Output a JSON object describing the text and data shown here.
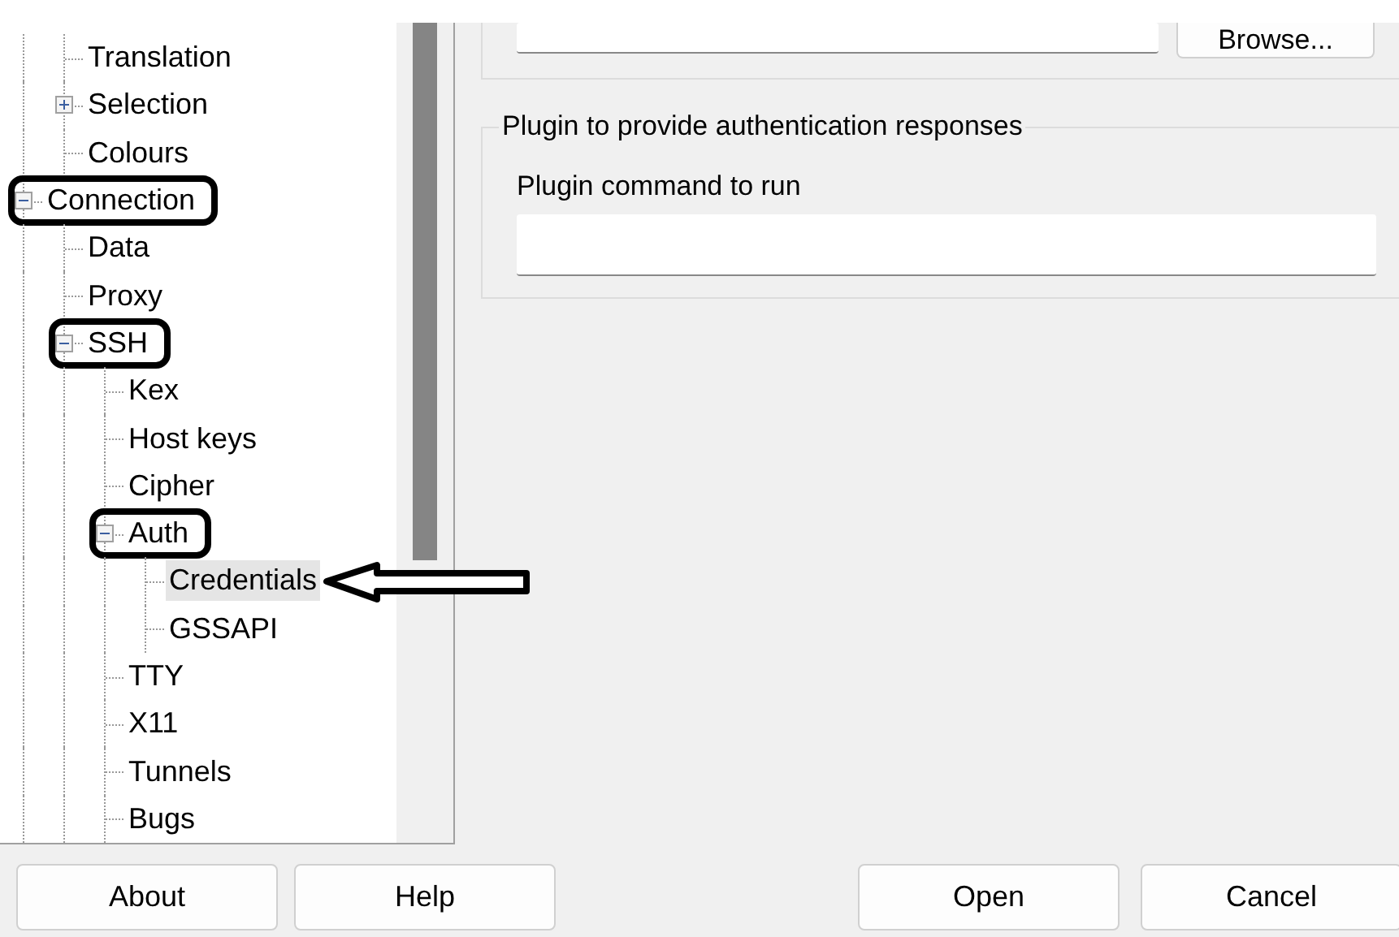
{
  "tree": [
    {
      "children": [
        {
          "label": "Translation",
          "selected": false
        },
        {
          "label": "Selection",
          "selected": false,
          "expanded": false
        },
        {
          "label": "Colours",
          "selected": false
        }
      ]
    },
    {
      "label": "Connection",
      "selected": false,
      "expanded": true,
      "circled": true,
      "children": [
        {
          "label": "Data",
          "selected": false
        },
        {
          "label": "Proxy",
          "selected": false
        },
        {
          "label": "SSH",
          "selected": false,
          "expanded": true,
          "circled": true,
          "children": [
            {
              "label": "Kex",
              "selected": false
            },
            {
              "label": "Host keys",
              "selected": false
            },
            {
              "label": "Cipher",
              "selected": false
            },
            {
              "label": "Auth",
              "selected": false,
              "expanded": true,
              "circled": true,
              "children": [
                {
                  "label": "Credentials",
                  "selected": true,
                  "arrow": true
                },
                {
                  "label": "GSSAPI",
                  "selected": false
                }
              ]
            },
            {
              "label": "TTY",
              "selected": false
            },
            {
              "label": "X11",
              "selected": false
            },
            {
              "label": "Tunnels",
              "selected": false
            },
            {
              "label": "Bugs",
              "selected": false
            }
          ]
        }
      ]
    }
  ],
  "upper_group": {
    "button": "Browse..."
  },
  "plugin_group": {
    "title": "Plugin to provide authentication responses",
    "field_label": "Plugin command to run"
  },
  "buttons": [
    {
      "label": "About"
    },
    {
      "label": "Help"
    },
    {
      "label": "Open"
    },
    {
      "label": "Cancel"
    }
  ]
}
